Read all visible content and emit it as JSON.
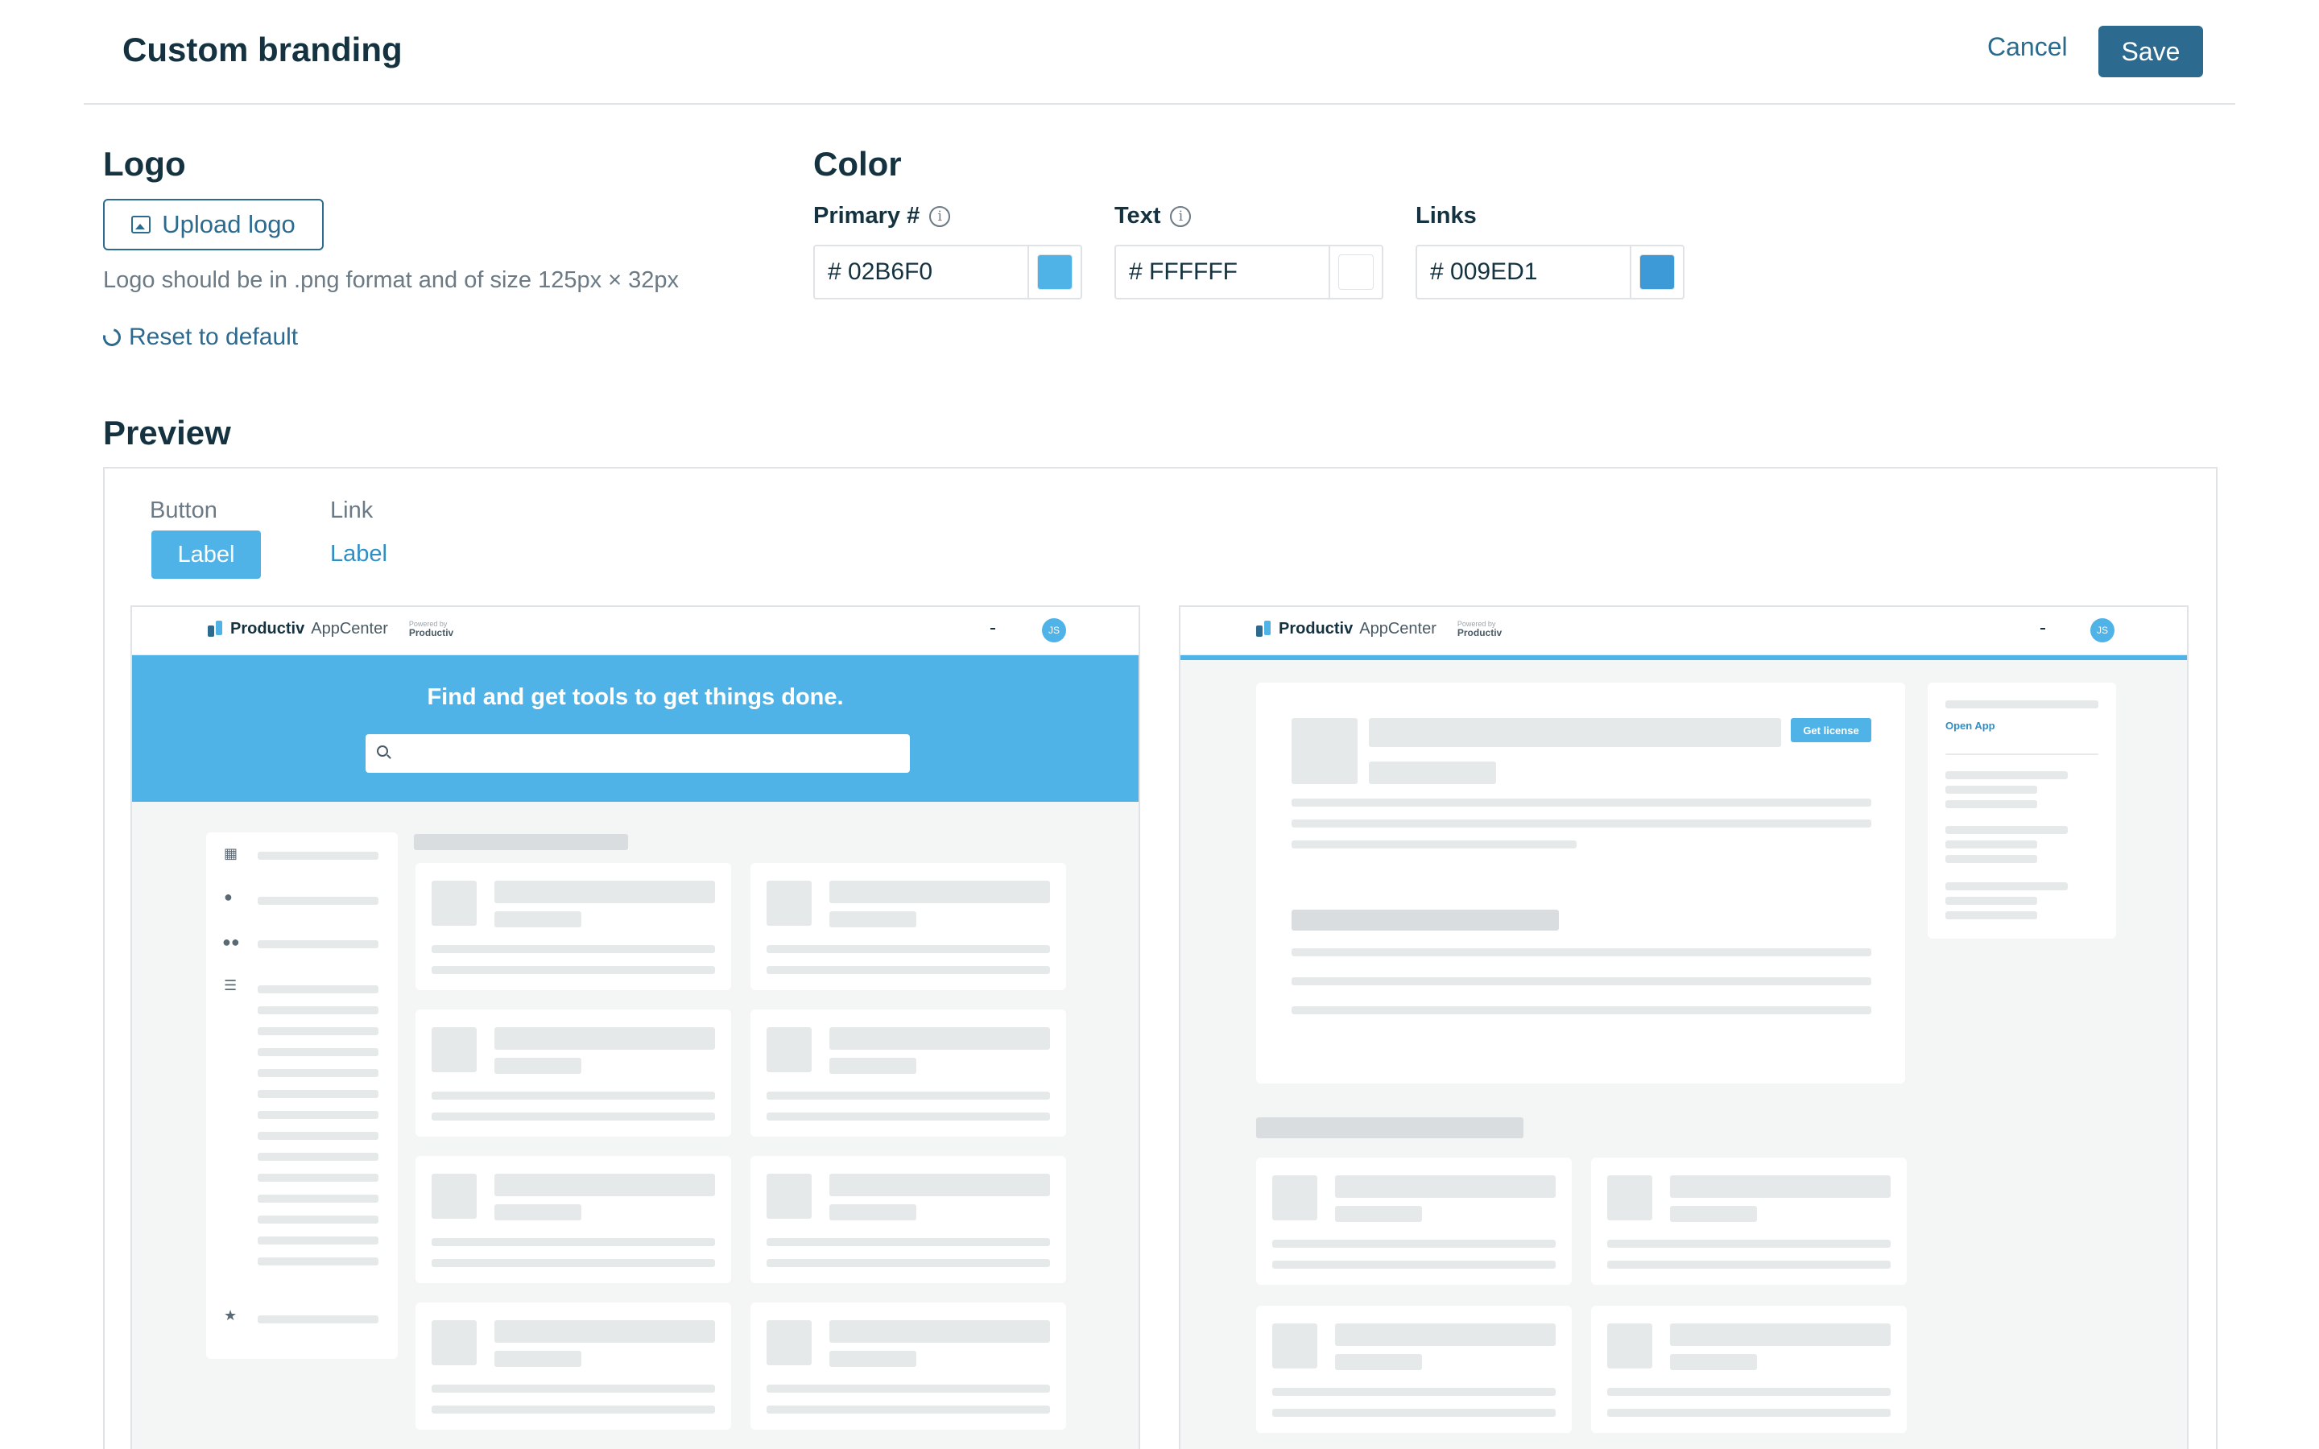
{
  "header": {
    "title": "Custom branding",
    "cancel_label": "Cancel",
    "save_label": "Save"
  },
  "logo": {
    "heading": "Logo",
    "upload_label": "Upload logo",
    "help_text": "Logo should be in .png format and of size 125px × 32px",
    "reset_label": "Reset to default"
  },
  "color": {
    "heading": "Color",
    "fields": [
      {
        "label": "Primary #",
        "value": "# 02B6F0",
        "swatch": "#50b3e8",
        "has_info": true
      },
      {
        "label": "Text",
        "value": "# FFFFFF",
        "swatch": "#ffffff",
        "has_info": true
      },
      {
        "label": "Links",
        "value": "# 009ED1",
        "swatch": "#3d9ad6",
        "has_info": false
      }
    ]
  },
  "preview": {
    "heading": "Preview",
    "button_caption": "Button",
    "button_label": "Label",
    "link_caption": "Link",
    "link_label": "Label",
    "hero_title": "Find and get tools to get things done.",
    "brand_name": "Productiv",
    "brand_sub": "AppCenter",
    "powered_by": "Powered by",
    "powered_brand": "Productiv",
    "avatar_initials": "JS",
    "get_license_label": "Get license",
    "open_app_label": "Open App"
  },
  "colors": {
    "primary": "#50b3e8",
    "accent_button": "#2d6a8f",
    "link": "#2e8fc7"
  }
}
